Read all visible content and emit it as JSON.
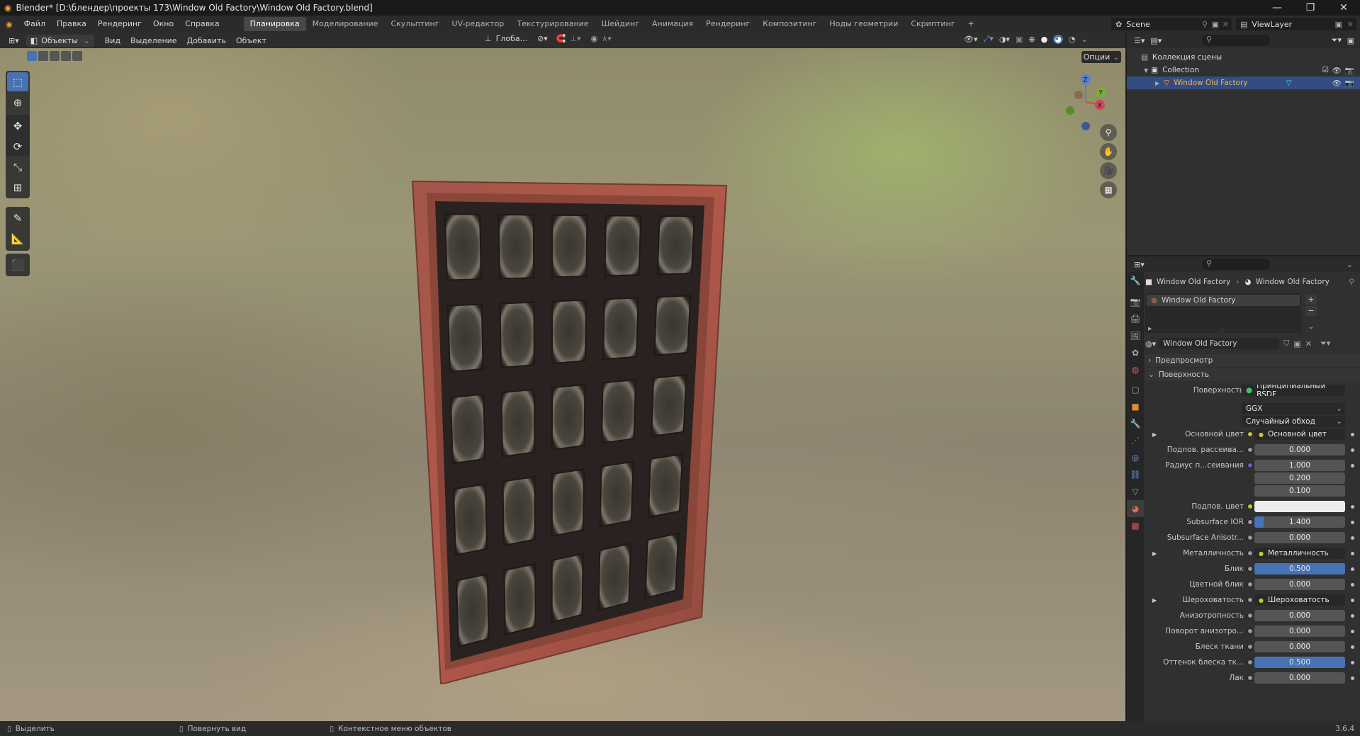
{
  "window": {
    "title": "Blender* [D:\\блендер\\проекты 173\\Window Old Factory\\Window Old Factory.blend]",
    "minimize": "—",
    "maximize": "❐",
    "close": "✕"
  },
  "menu": [
    "Файл",
    "Правка",
    "Рендеринг",
    "Окно",
    "Справка"
  ],
  "workspaces": [
    "Планировка",
    "Моделирование",
    "Скульптинг",
    "UV-редактор",
    "Текстурирование",
    "Шейдинг",
    "Анимация",
    "Рендеринг",
    "Композитинг",
    "Ноды геометрии",
    "Скриптинг"
  ],
  "workspace_add": "+",
  "scene": {
    "label": "Scene",
    "viewlayer": "ViewLayer"
  },
  "viewport": {
    "mode": "Объекты",
    "menus": [
      "Вид",
      "Выделение",
      "Добавить",
      "Объект"
    ],
    "orientation": "Глоба...",
    "options": "Опции",
    "gizmo": {
      "z": "Z",
      "y": "Y",
      "x": "X"
    }
  },
  "tools": [
    "select-box",
    "cursor",
    "move",
    "rotate",
    "scale",
    "transform",
    "annotate",
    "measure",
    "add-cube"
  ],
  "outliner": {
    "search_placeholder": "",
    "scene_collection": "Коллекция сцены",
    "collection": "Collection",
    "object": "Window Old Factory"
  },
  "properties": {
    "breadcrumb_object": "Window Old Factory",
    "breadcrumb_material": "Window Old Factory",
    "slot_name": "Window Old Factory",
    "material_name": "Window Old Factory",
    "preview_label": "Предпросмотр",
    "surface_panel": "Поверхность",
    "surface_label": "Поверхность",
    "surface_value": "Принципиальный BSDF",
    "distribution": "GGX",
    "subsurface_method": "Случайный обход",
    "rows": [
      {
        "label": "Основной цвет",
        "value": "Основной цвет",
        "kind": "link",
        "dot": "yellow",
        "expand": true
      },
      {
        "label": "Подпов. рассеива...",
        "value": "0.000",
        "kind": "num",
        "dot": "grey"
      },
      {
        "label": "Радиус п...сеивания",
        "value": "1.000",
        "kind": "num",
        "dot": "blue"
      },
      {
        "label": "",
        "value": "0.200",
        "kind": "num",
        "dot": ""
      },
      {
        "label": "",
        "value": "0.100",
        "kind": "num",
        "dot": ""
      },
      {
        "label": "Подпов. цвет",
        "value": "",
        "kind": "color",
        "dot": "yellow"
      },
      {
        "label": "Subsurface IOR",
        "value": "1.400",
        "kind": "bar",
        "dot": "grey",
        "fill": 0.1
      },
      {
        "label": "Subsurface Anisotr...",
        "value": "0.000",
        "kind": "num",
        "dot": "grey"
      },
      {
        "label": "Металличность",
        "value": "Металличность",
        "kind": "link",
        "dot": "grey",
        "expand": true
      },
      {
        "label": "Блик",
        "value": "0.500",
        "kind": "bar",
        "dot": "grey",
        "fill": 1.0
      },
      {
        "label": "Цветной блик",
        "value": "0.000",
        "kind": "num",
        "dot": "grey"
      },
      {
        "label": "Шероховатость",
        "value": "Шероховатость",
        "kind": "link",
        "dot": "grey",
        "expand": true
      },
      {
        "label": "Анизотропность",
        "value": "0.000",
        "kind": "num",
        "dot": "grey"
      },
      {
        "label": "Поворот анизотро...",
        "value": "0.000",
        "kind": "num",
        "dot": "grey"
      },
      {
        "label": "Блеск ткани",
        "value": "0.000",
        "kind": "num",
        "dot": "grey"
      },
      {
        "label": "Оттенок блеска тк...",
        "value": "0.500",
        "kind": "bar",
        "dot": "grey",
        "fill": 1.0
      },
      {
        "label": "Лак",
        "value": "0.000",
        "kind": "num",
        "dot": "grey"
      }
    ]
  },
  "status": {
    "select": "Выделить",
    "rotate": "Повернуть вид",
    "context": "Контекстное меню объектов",
    "version": "3.6.4"
  },
  "colors": {
    "accent": "#4772b3",
    "selected_row": "#334d80",
    "object_name": "#f0b25a"
  }
}
